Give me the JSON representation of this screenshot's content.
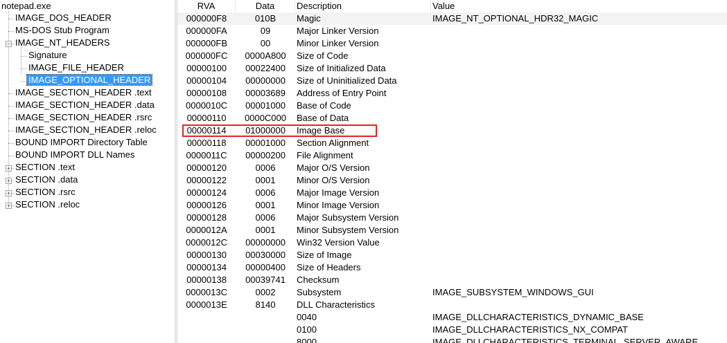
{
  "tree": {
    "root": "notepad.exe",
    "items": [
      {
        "label": "IMAGE_DOS_HEADER",
        "expander": ""
      },
      {
        "label": "MS-DOS Stub Program",
        "expander": ""
      },
      {
        "label": "IMAGE_NT_HEADERS",
        "expander": "−"
      },
      {
        "label": "Signature",
        "expander": ""
      },
      {
        "label": "IMAGE_FILE_HEADER",
        "expander": ""
      },
      {
        "label": "IMAGE_OPTIONAL_HEADER",
        "expander": "",
        "selected": true
      },
      {
        "label": "IMAGE_SECTION_HEADER .text",
        "expander": ""
      },
      {
        "label": "IMAGE_SECTION_HEADER .data",
        "expander": ""
      },
      {
        "label": "IMAGE_SECTION_HEADER .rsrc",
        "expander": ""
      },
      {
        "label": "IMAGE_SECTION_HEADER .reloc",
        "expander": ""
      },
      {
        "label": "BOUND IMPORT Directory Table",
        "expander": ""
      },
      {
        "label": "BOUND IMPORT DLL Names",
        "expander": ""
      },
      {
        "label": "SECTION .text",
        "expander": "+"
      },
      {
        "label": "SECTION .data",
        "expander": "+"
      },
      {
        "label": "SECTION .rsrc",
        "expander": "+"
      },
      {
        "label": "SECTION .reloc",
        "expander": "+"
      }
    ]
  },
  "columns": {
    "rva": "RVA",
    "data": "Data",
    "description": "Description",
    "value": "Value"
  },
  "rows": [
    {
      "rva": "000000F8",
      "data": "010B",
      "desc": "Magic",
      "value": "IMAGE_NT_OPTIONAL_HDR32_MAGIC"
    },
    {
      "rva": "000000FA",
      "data": "09",
      "desc": "Major Linker Version",
      "value": ""
    },
    {
      "rva": "000000FB",
      "data": "00",
      "desc": "Minor Linker Version",
      "value": ""
    },
    {
      "rva": "000000FC",
      "data": "0000A800",
      "desc": "Size of Code",
      "value": ""
    },
    {
      "rva": "00000100",
      "data": "00022400",
      "desc": "Size of Initialized Data",
      "value": ""
    },
    {
      "rva": "00000104",
      "data": "00000000",
      "desc": "Size of Uninitialized Data",
      "value": ""
    },
    {
      "rva": "00000108",
      "data": "00003689",
      "desc": "Address of Entry Point",
      "value": ""
    },
    {
      "rva": "0000010C",
      "data": "00001000",
      "desc": "Base of Code",
      "value": ""
    },
    {
      "rva": "00000110",
      "data": "0000C000",
      "desc": "Base of Data",
      "value": ""
    },
    {
      "rva": "00000114",
      "data": "01000000",
      "desc": "Image Base",
      "value": ""
    },
    {
      "rva": "00000118",
      "data": "00001000",
      "desc": "Section Alignment",
      "value": ""
    },
    {
      "rva": "0000011C",
      "data": "00000200",
      "desc": "File Alignment",
      "value": ""
    },
    {
      "rva": "00000120",
      "data": "0006",
      "desc": "Major O/S Version",
      "value": ""
    },
    {
      "rva": "00000122",
      "data": "0001",
      "desc": "Minor O/S Version",
      "value": ""
    },
    {
      "rva": "00000124",
      "data": "0006",
      "desc": "Major Image Version",
      "value": ""
    },
    {
      "rva": "00000126",
      "data": "0001",
      "desc": "Minor Image Version",
      "value": ""
    },
    {
      "rva": "00000128",
      "data": "0006",
      "desc": "Major Subsystem Version",
      "value": ""
    },
    {
      "rva": "0000012A",
      "data": "0001",
      "desc": "Minor Subsystem Version",
      "value": ""
    },
    {
      "rva": "0000012C",
      "data": "00000000",
      "desc": "Win32 Version Value",
      "value": ""
    },
    {
      "rva": "00000130",
      "data": "00030000",
      "desc": "Size of Image",
      "value": ""
    },
    {
      "rva": "00000134",
      "data": "00000400",
      "desc": "Size of Headers",
      "value": ""
    },
    {
      "rva": "00000138",
      "data": "00039741",
      "desc": "Checksum",
      "value": ""
    },
    {
      "rva": "0000013C",
      "data": "0002",
      "desc": "Subsystem",
      "value": "IMAGE_SUBSYSTEM_WINDOWS_GUI"
    },
    {
      "rva": "0000013E",
      "data": "8140",
      "desc": "DLL Characteristics",
      "value": ""
    },
    {
      "rva": "",
      "data": "",
      "desc": "0040",
      "value": "IMAGE_DLLCHARACTERISTICS_DYNAMIC_BASE"
    },
    {
      "rva": "",
      "data": "",
      "desc": "0100",
      "value": "IMAGE_DLLCHARACTERISTICS_NX_COMPAT"
    },
    {
      "rva": "",
      "data": "",
      "desc": "8000",
      "value": "IMAGE_DLLCHARACTERISTICS_TERMINAL_SERVER_AWARE"
    }
  ],
  "highlighted_row": "Image Base",
  "colors": {
    "selection": "#3399ff",
    "highlight_box": "#e0242b"
  }
}
